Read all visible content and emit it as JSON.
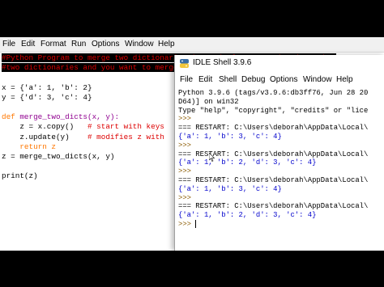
{
  "editor": {
    "menu": [
      "File",
      "Edit",
      "Format",
      "Run",
      "Options",
      "Window",
      "Help"
    ],
    "code": [
      {
        "kind": "comment",
        "text": "#Python Program to merge two dictionaries in a single expression in Python"
      },
      {
        "kind": "comment",
        "text": "#two dictionaries and you want to merge"
      },
      {
        "kind": "blank",
        "text": ""
      },
      {
        "kind": "plain",
        "text": "x = {'a': 1, 'b': 2}"
      },
      {
        "kind": "plain",
        "text": "y = {'d': 3, 'c': 4}"
      },
      {
        "kind": "blank",
        "text": ""
      },
      {
        "kind": "def",
        "text": "def merge_two_dicts(x, y):"
      },
      {
        "kind": "code_comment",
        "text": "    z = x.copy()",
        "comment": "   # start with keys"
      },
      {
        "kind": "code_comment",
        "text": "    z.update(y)",
        "comment": "    # modifies z with"
      },
      {
        "kind": "return",
        "text": "    return z"
      },
      {
        "kind": "plain",
        "text": "z = merge_two_dicts(x, y)"
      },
      {
        "kind": "blank",
        "text": ""
      },
      {
        "kind": "plain",
        "text": "print(z)"
      }
    ]
  },
  "shell": {
    "title": "IDLE Shell 3.9.6",
    "menu": [
      "File",
      "Edit",
      "Shell",
      "Debug",
      "Options",
      "Window",
      "Help"
    ],
    "lines": [
      {
        "kind": "restart",
        "text": "Python 3.9.6 (tags/v3.9.6:db3ff76, Jun 28 20"
      },
      {
        "kind": "restart",
        "text": "D64)] on win32"
      },
      {
        "kind": "restart",
        "text": "Type \"help\", \"copyright\", \"credits\" or \"lice"
      },
      {
        "kind": "prompt",
        "text": ">>> "
      },
      {
        "kind": "restart",
        "text": "=== RESTART: C:\\Users\\deborah\\AppData\\Local\\"
      },
      {
        "kind": "out",
        "text": "{'a': 1, 'b': 3, 'c': 4}"
      },
      {
        "kind": "prompt",
        "text": ">>> "
      },
      {
        "kind": "restart",
        "text": "=== RESTART: C:\\Users\\deborah\\AppData\\Local\\"
      },
      {
        "kind": "out",
        "text": "{'a': 1, 'b': 2, 'd': 3, 'c': 4}"
      },
      {
        "kind": "prompt",
        "text": ">>> "
      },
      {
        "kind": "restart",
        "text": "=== RESTART: C:\\Users\\deborah\\AppData\\Local\\"
      },
      {
        "kind": "out",
        "text": "{'a': 1, 'b': 3, 'c': 4}"
      },
      {
        "kind": "prompt",
        "text": ">>> "
      },
      {
        "kind": "restart",
        "text": "=== RESTART: C:\\Users\\deborah\\AppData\\Local\\"
      },
      {
        "kind": "out",
        "text": "{'a': 1, 'b': 2, 'd': 3, 'c': 4}"
      },
      {
        "kind": "prompt_cursor",
        "text": ">>> "
      }
    ]
  },
  "colors": {
    "comment": "#dd0000",
    "keyword": "#ff7700",
    "output": "#0000cc",
    "prompt": "#8a5a00"
  }
}
